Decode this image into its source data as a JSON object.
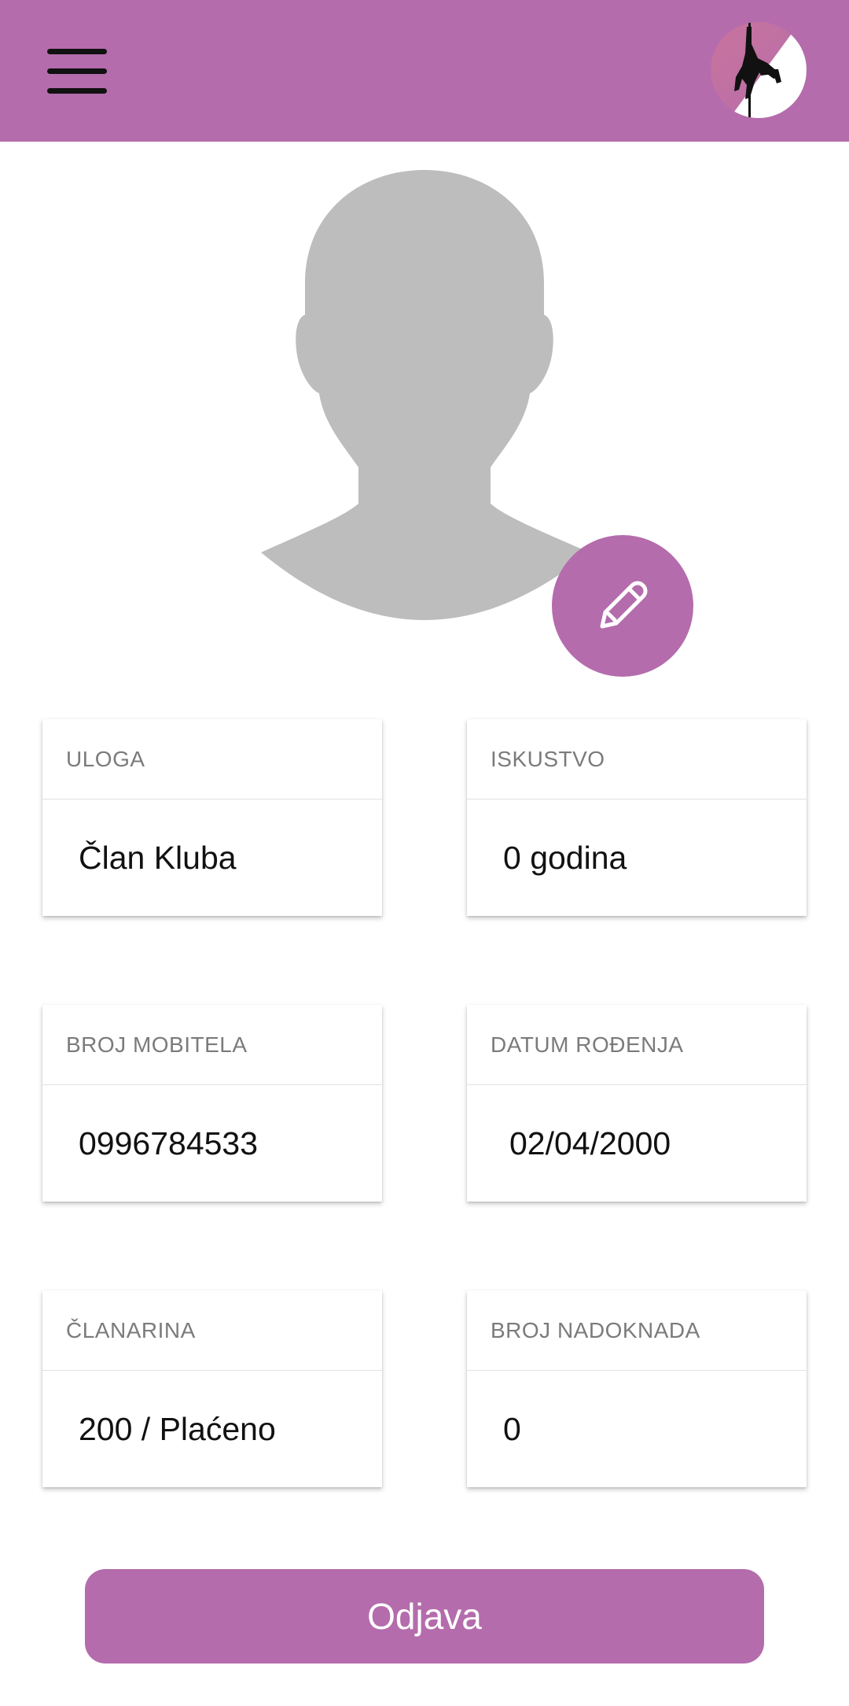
{
  "theme": {
    "accent": "#b46cac",
    "avatar_placeholder": "#bdbdbd"
  },
  "header": {
    "menu_icon": "hamburger-menu-icon",
    "logo_icon": "pole-dancer-logo"
  },
  "profile": {
    "avatar_icon": "person-placeholder-icon",
    "edit_icon": "pencil-icon"
  },
  "fields": {
    "role": {
      "label": "ULOGA",
      "value": "Član Kluba"
    },
    "experience": {
      "label": "ISKUSTVO",
      "value": "0 godina"
    },
    "phone": {
      "label": "BROJ MOBITELA",
      "value": "0996784533"
    },
    "birthdate": {
      "label": "DATUM ROĐENJA",
      "value": "02/04/2000"
    },
    "membership": {
      "label": "ČLANARINA",
      "value": "200 / Plaćeno"
    },
    "makeups": {
      "label": "BROJ NADOKNADA",
      "value": "0"
    }
  },
  "actions": {
    "logout_label": "Odjava"
  }
}
